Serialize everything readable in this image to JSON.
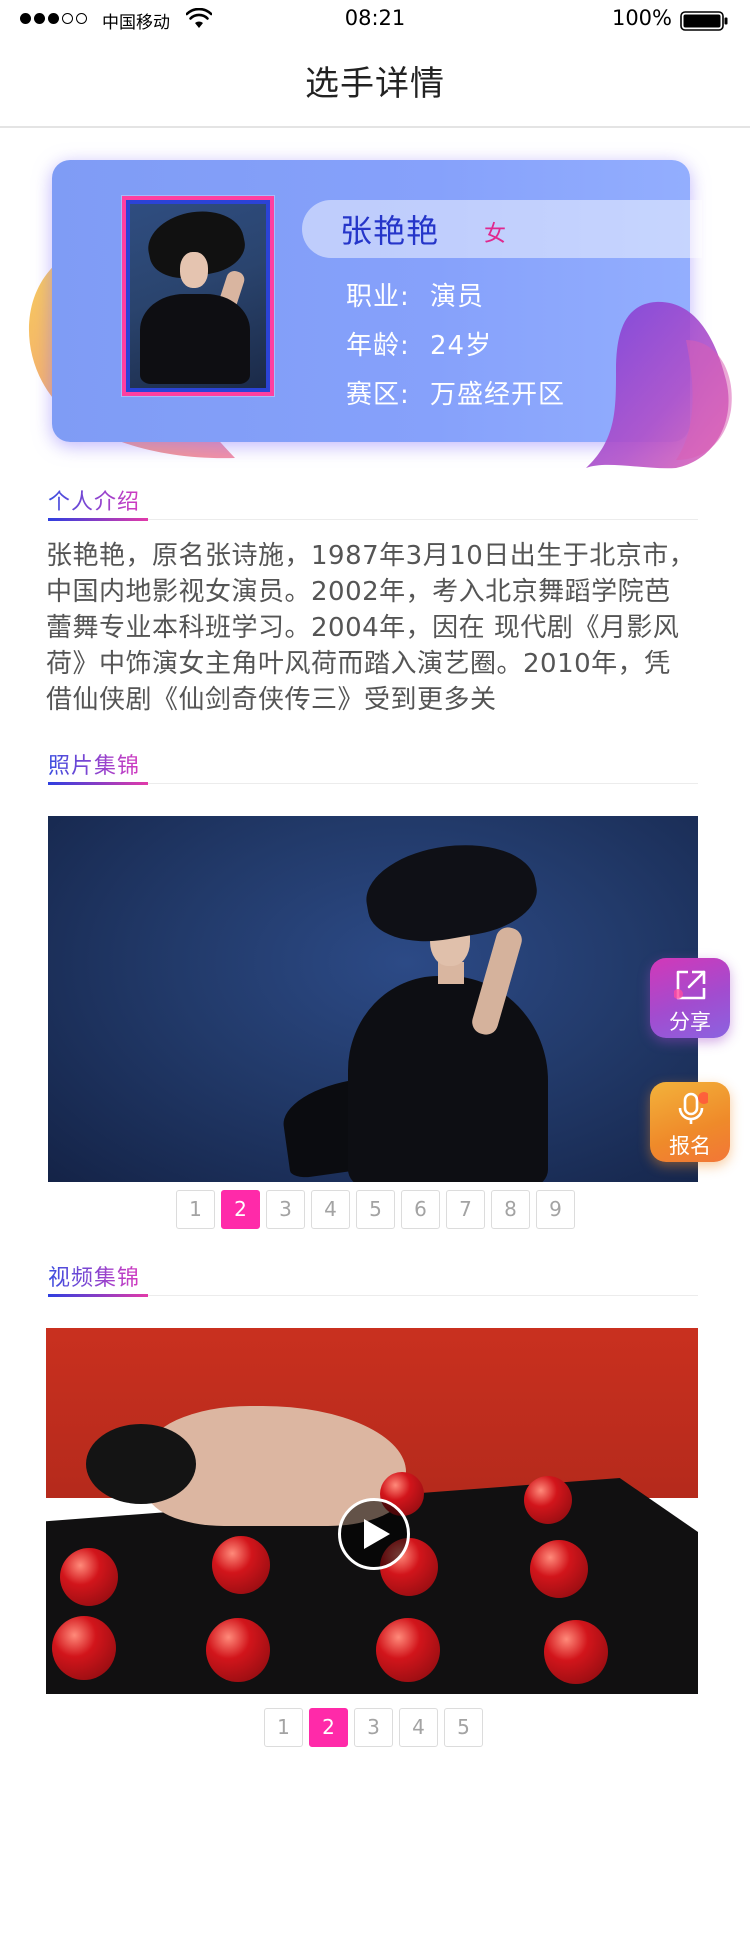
{
  "status_bar": {
    "carrier": "中国移动",
    "time": "08:21",
    "battery": "100%"
  },
  "nav": {
    "title": "选手详情"
  },
  "profile": {
    "name": "张艳艳",
    "gender": "女",
    "occupation_label": "职业:",
    "occupation": "演员",
    "age_label": "年龄:",
    "age": "24岁",
    "district_label": "赛区:",
    "district": "万盛经开区"
  },
  "sections": {
    "intro": "个人介绍",
    "photos": "照片集锦",
    "videos": "视频集锦"
  },
  "intro_text": "张艳艳，原名张诗施，1987年3月10日出生于北京市，中国内地影视女演员。2002年，考入北京舞蹈学院芭蕾舞专业本科班学习。2004年，因在 现代剧《月影风荷》中饰演女主角叶风荷而踏入演艺圈。2010年，凭借仙侠剧《仙剑奇侠传三》受到更多关",
  "photo_pager": {
    "pages": [
      "1",
      "2",
      "3",
      "4",
      "5",
      "6",
      "7",
      "8",
      "9"
    ],
    "active": "2"
  },
  "video_pager": {
    "pages": [
      "1",
      "2",
      "3",
      "4",
      "5"
    ],
    "active": "2"
  },
  "floating": {
    "share": "分享",
    "signup": "报名"
  },
  "icons": {
    "wifi": "wifi-icon",
    "battery": "battery-icon",
    "play": "play-icon",
    "share": "share-icon",
    "mic": "microphone-icon"
  },
  "colors": {
    "accent_pink": "#ff2aa9",
    "card_blue": "#86a1fb",
    "name_blue": "#2535c9"
  }
}
